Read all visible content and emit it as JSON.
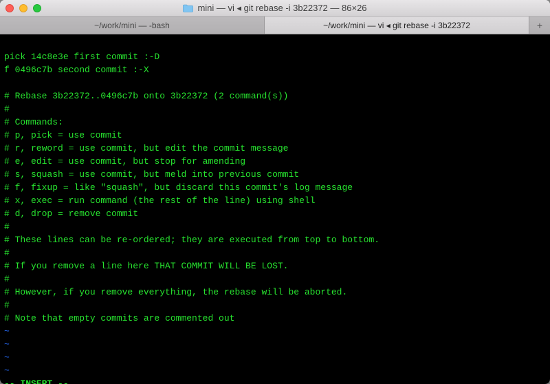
{
  "titlebar": {
    "title": "mini — vi ◂ git rebase -i 3b22372 — 86×26"
  },
  "tabs": {
    "tab1": "~/work/mini — -bash",
    "tab2": "~/work/mini — vi ◂ git rebase -i 3b22372",
    "add": "+"
  },
  "terminal": {
    "lines": [
      "pick 14c8e3e first commit :-D",
      "f 0496c7b second commit :-X",
      "",
      "# Rebase 3b22372..0496c7b onto 3b22372 (2 command(s))",
      "#",
      "# Commands:",
      "# p, pick = use commit",
      "# r, reword = use commit, but edit the commit message",
      "# e, edit = use commit, but stop for amending",
      "# s, squash = use commit, but meld into previous commit",
      "# f, fixup = like \"squash\", but discard this commit's log message",
      "# x, exec = run command (the rest of the line) using shell",
      "# d, drop = remove commit",
      "#",
      "# These lines can be re-ordered; they are executed from top to bottom.",
      "#",
      "# If you remove a line here THAT COMMIT WILL BE LOST.",
      "#",
      "# However, if you remove everything, the rebase will be aborted.",
      "#",
      "# Note that empty commits are commented out"
    ],
    "tilde": "~",
    "status": "-- INSERT --"
  }
}
